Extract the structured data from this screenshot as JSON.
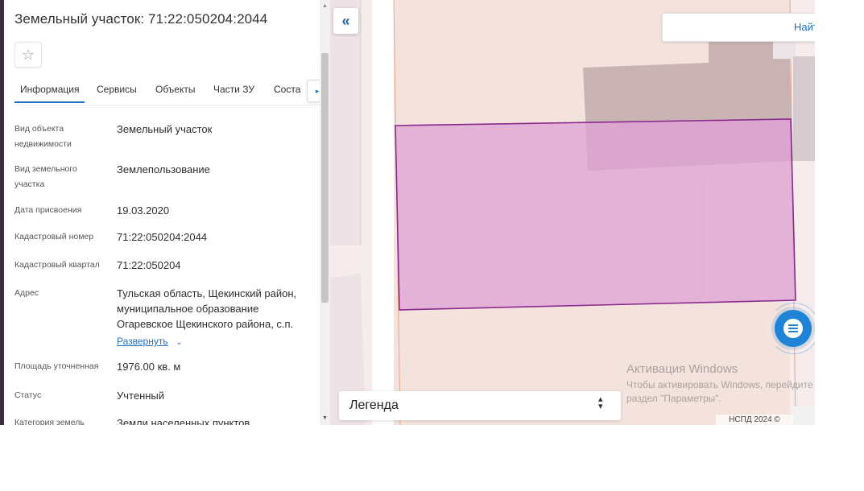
{
  "panel": {
    "title": "Земельный участок: 71:22:050204:2044",
    "star_icon": "☆",
    "tabs": [
      "Информация",
      "Сервисы",
      "Объекты",
      "Части ЗУ",
      "Соста"
    ],
    "tabs_next_icon": "▸",
    "fields": [
      {
        "label": "Вид объекта недвижимости",
        "value": "Земельный участок"
      },
      {
        "label": "Вид земельного участка",
        "value": "Землепользование"
      },
      {
        "label": "Дата присвоения",
        "value": "19.03.2020"
      },
      {
        "label": "Кадастровый номер",
        "value": "71:22:050204:2044"
      },
      {
        "label": "Кадастровый квартал",
        "value": "71:22:050204"
      },
      {
        "label": "Адрес",
        "value": "Тульская область, Щекинский район, муниципальное образование Огаревское Щекинского района, с.п."
      },
      {
        "label": "Площадь уточненная",
        "value": "1976.00 кв. м"
      },
      {
        "label": "Статус",
        "value": "Учтенный"
      },
      {
        "label": "Категория земель",
        "value": "Земли населенных пунктов"
      }
    ],
    "expand_label": "Развернуть",
    "expand_icon": "⌄"
  },
  "scroll": {
    "up_icon": "▲",
    "down_icon": "▼"
  },
  "map": {
    "collapse_icon": "«",
    "search_button": "Найти",
    "chat_icon": "chat-bubble-icon",
    "legend_label": "Легенда",
    "legend_toggle_icon": "⌃⌄",
    "watermark_title": "Активация Windows",
    "watermark_line1": "Чтобы активировать Windows, перейдите в",
    "watermark_line2": "раздел \"Параметры\".",
    "copyright": "НСПД 2024 ©",
    "colors": {
      "parcel_fill": "#dfa3d6",
      "parcel_stroke": "#8a2a8e",
      "accent": "#1f6fc5"
    }
  }
}
